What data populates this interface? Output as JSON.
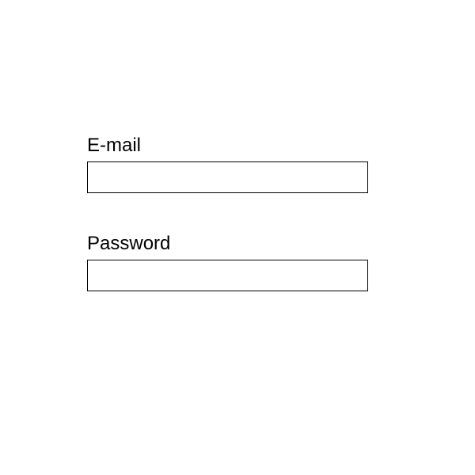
{
  "form": {
    "email": {
      "label": "E-mail",
      "value": ""
    },
    "password": {
      "label": "Password",
      "value": ""
    }
  }
}
